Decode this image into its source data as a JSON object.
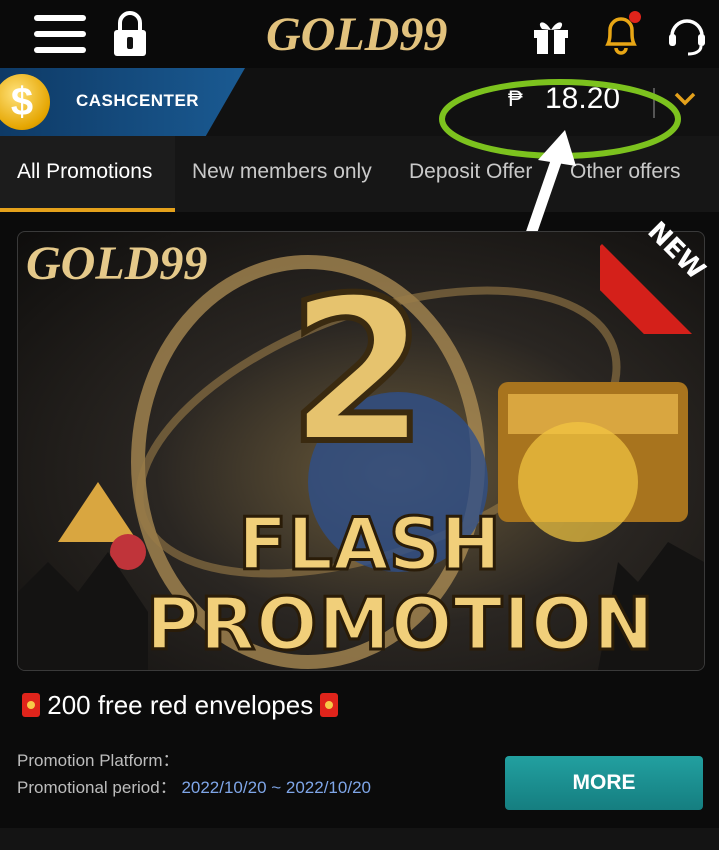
{
  "header": {
    "logo_text": "GOLD99"
  },
  "cash": {
    "label": "CASHCENTER",
    "currency_symbol": "₱",
    "balance": "18.20"
  },
  "tabs": [
    {
      "label": "All Promotions",
      "active": true
    },
    {
      "label": "New members only",
      "active": false
    },
    {
      "label": "Deposit Offer",
      "active": false
    },
    {
      "label": "Other offers",
      "active": false
    }
  ],
  "banner": {
    "logo": "GOLD99",
    "badge": "NEW",
    "number": "2",
    "line1": "FLASH",
    "line2": "PROMOTION"
  },
  "promotion": {
    "title": "200 free red envelopes",
    "platform_label": "Promotion Platform：",
    "period_label": "Promotional period：",
    "period_value": "2022/10/20 ~ 2022/10/20",
    "more_label": "MORE"
  },
  "colors": {
    "accent": "#e4a11b",
    "annotation": "#7cc21e",
    "button": "#1a8f90"
  }
}
